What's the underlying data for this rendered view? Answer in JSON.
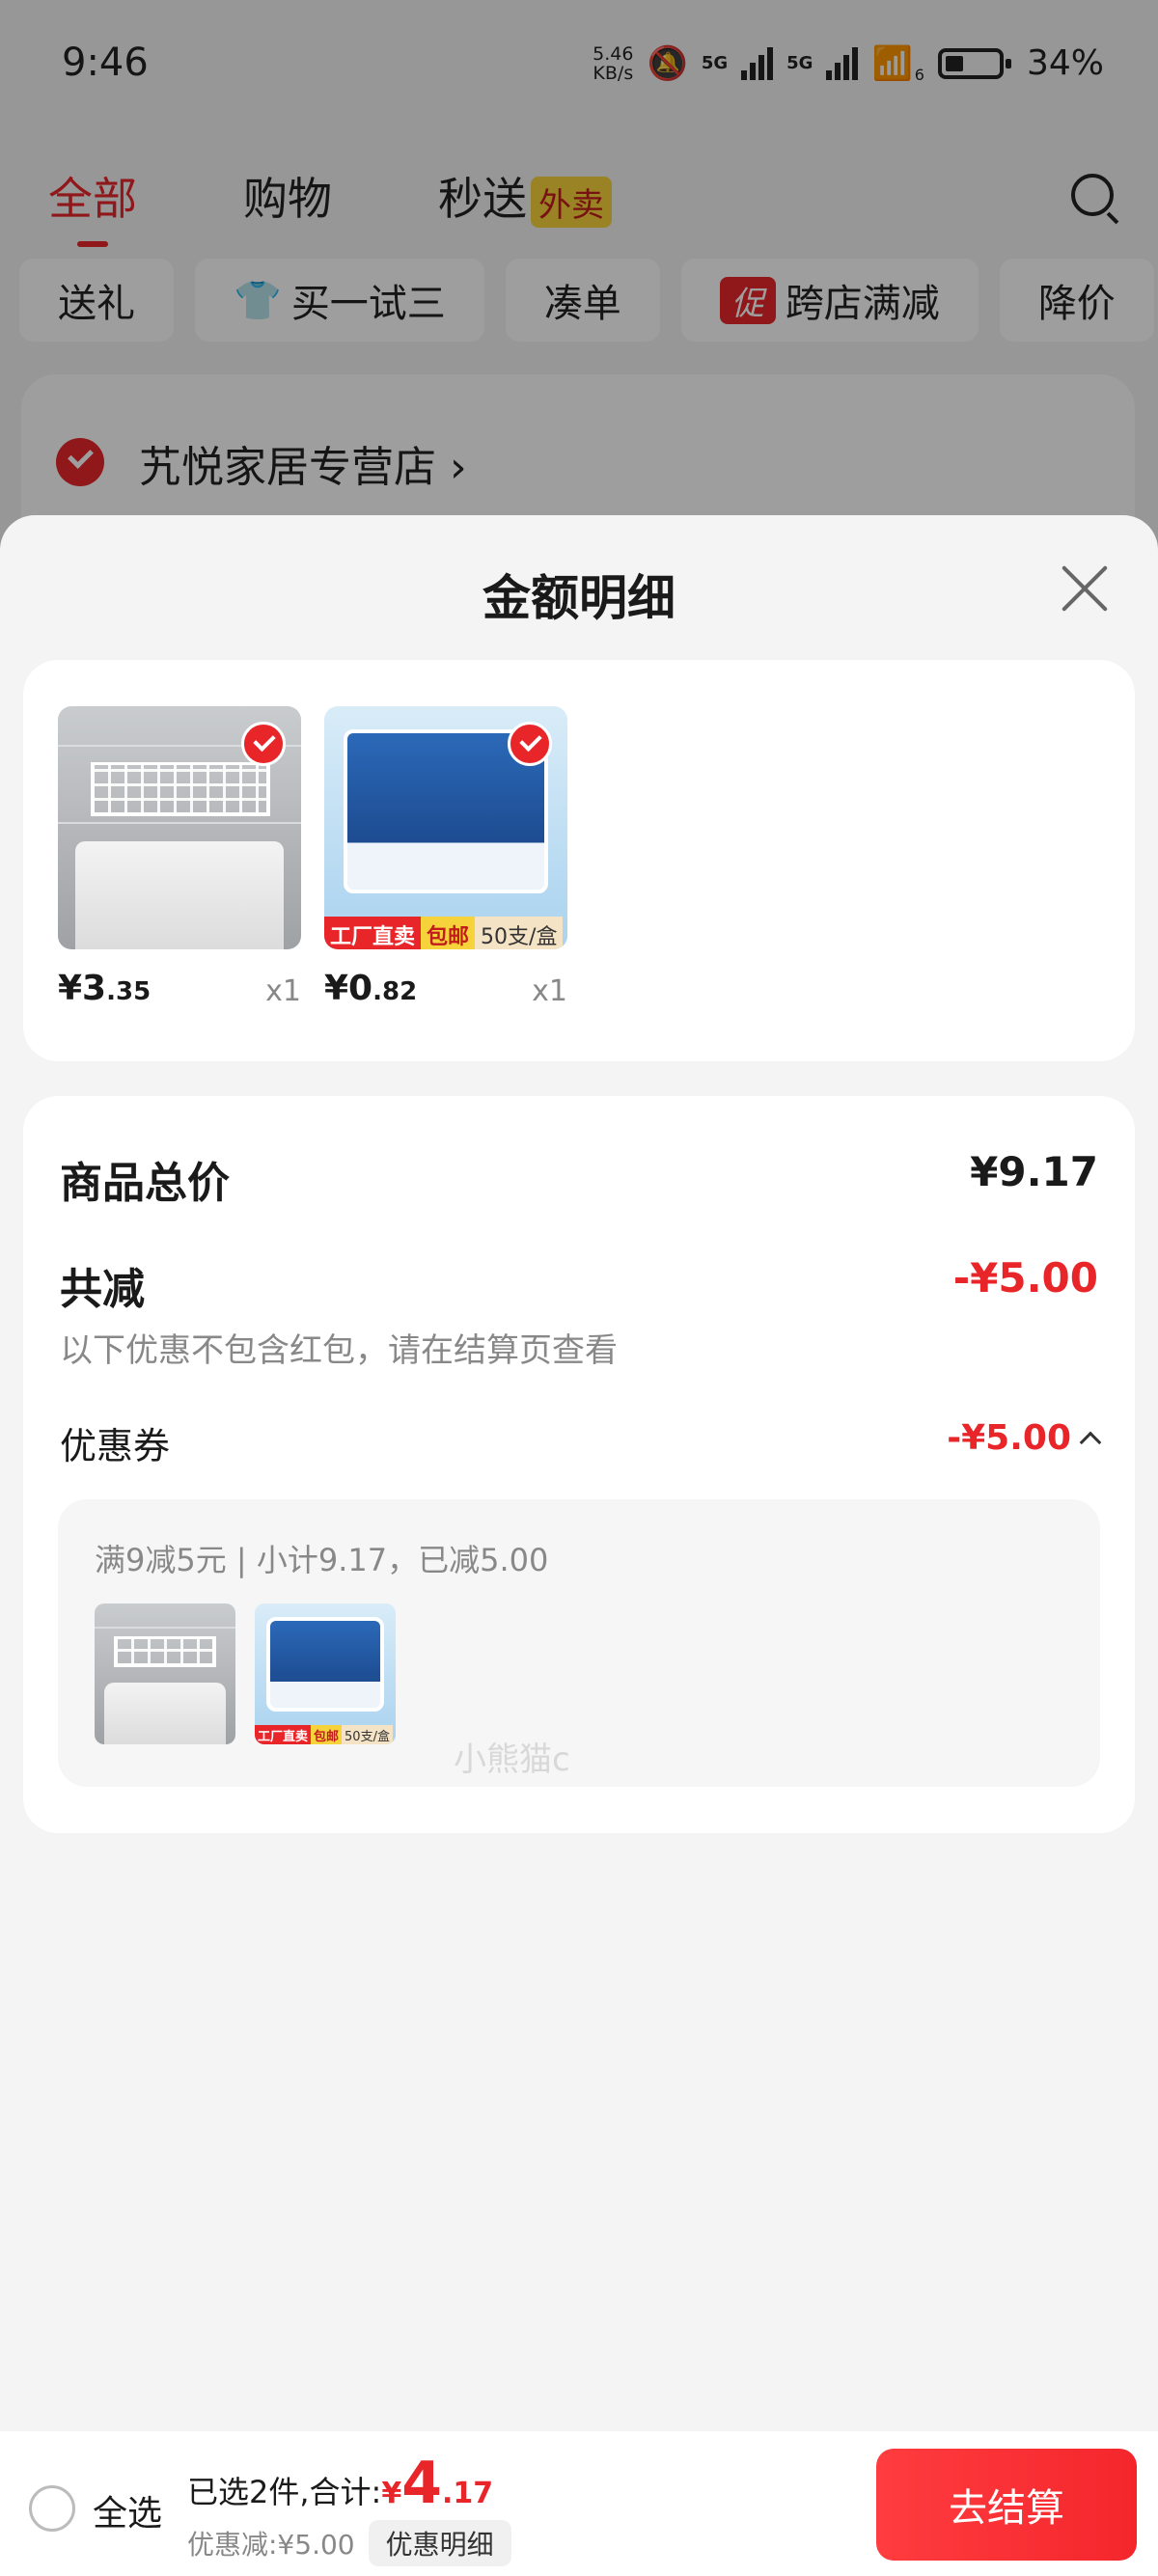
{
  "status_bar": {
    "time": "9:46",
    "net_speed_value": "5.46",
    "net_speed_unit": "KB/s",
    "signal1": "5G",
    "signal2": "5G",
    "wifi_sub": "6",
    "battery": "34%"
  },
  "tabs": [
    {
      "label": "全部"
    },
    {
      "label": "购物"
    },
    {
      "label": "秒送",
      "badge": "外卖"
    }
  ],
  "chips": [
    {
      "label": "送礼"
    },
    {
      "label": "买一试三"
    },
    {
      "label": "凑单"
    },
    {
      "label": "跨店满减",
      "tag": "促"
    },
    {
      "label": "降价"
    }
  ],
  "shop": {
    "name": "艽悦家居专营店 ›"
  },
  "sheet": {
    "title": "金额明细",
    "products": [
      {
        "price_int": "¥3",
        "price_dec": ".35",
        "qty": "x1"
      },
      {
        "price_int": "¥0",
        "price_dec": ".82",
        "qty": "x1",
        "banner": [
          "工厂直卖",
          "包邮",
          "50支/盒"
        ]
      }
    ],
    "total_label": "商品总价",
    "total_value": "¥9.17",
    "discount_label": "共减",
    "discount_value": "-¥5.00",
    "discount_note": "以下优惠不包含红包，请在结算页查看",
    "coupon_label": "优惠券",
    "coupon_value": "-¥5.00",
    "coupon_desc": "满9减5元 | 小计9.17，已减5.00",
    "watermark": "小熊猫c"
  },
  "bottom_bar": {
    "select_all": "全选",
    "selected_text": "已选2件,合计:",
    "sum_yen": "¥",
    "sum_int": "4",
    "sum_dec": ".17",
    "saved_text": "优惠减:¥5.00",
    "detail_button": "优惠明细",
    "checkout_button": "去结算"
  },
  "colors": {
    "accent": "#e8262a",
    "background": "#f4f4f5"
  }
}
